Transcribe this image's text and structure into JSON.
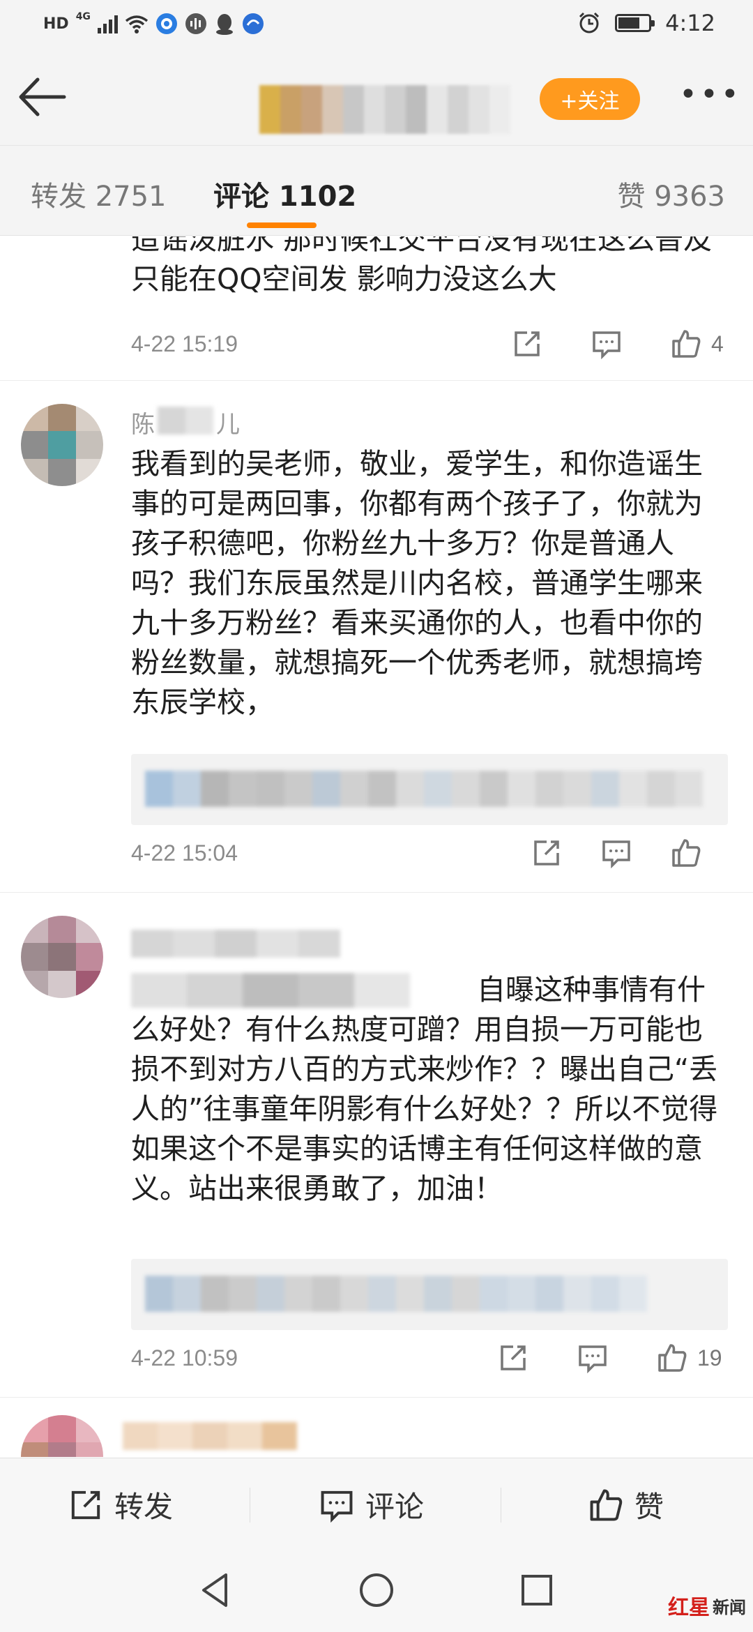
{
  "status_bar": {
    "hd": "HD",
    "network": "4G",
    "time": "4:12"
  },
  "header": {
    "follow_label": "+关注",
    "more_label": "•••"
  },
  "tabs": {
    "repost": "转发 2751",
    "comments": "评论 1102",
    "likes": "赞 9363"
  },
  "comments": [
    {
      "text": "造谣泼脏水 那时候社交平台没有现在这么普及 只能在QQ空间发 影响力没这么大",
      "time": "4-22 15:19",
      "likes": "4"
    },
    {
      "name": "陈",
      "name_end": "儿",
      "text": "我看到的吴老师，敬业，爱学生，和你造谣生事的可是两回事，你都有两个孩子了，你就为孩子积德吧，你粉丝九十多万？你是普通人吗？我们东辰虽然是川内名校，普通学生哪来九十多万粉丝？看来买通你的人，也看中你的粉丝数量，就想搞死一个优秀老师，就想搞垮东辰学校，",
      "time": "4-22 15:04",
      "likes": ""
    },
    {
      "text_visible": "自曝这种事情有什么好处？有什么热度可蹭？用自损一万可能也损不到对方八百的方式来炒作？？曝出自己“丢人的”往事童年阴影有什么好处？？所以不觉得如果这个不是事实的话博主有任何这样做的意义。站出来很勇敢了，加油！",
      "time": "4-22 10:59",
      "likes": "19"
    }
  ],
  "bottom_bar": {
    "repost": "转发",
    "comment": "评论",
    "like": "赞"
  },
  "watermark": {
    "red": "红星",
    "text": "新闻"
  },
  "colors": {
    "accent": "#ff8200",
    "follow_bg": "#ff9a1e",
    "watermark_red": "#d4201b"
  }
}
